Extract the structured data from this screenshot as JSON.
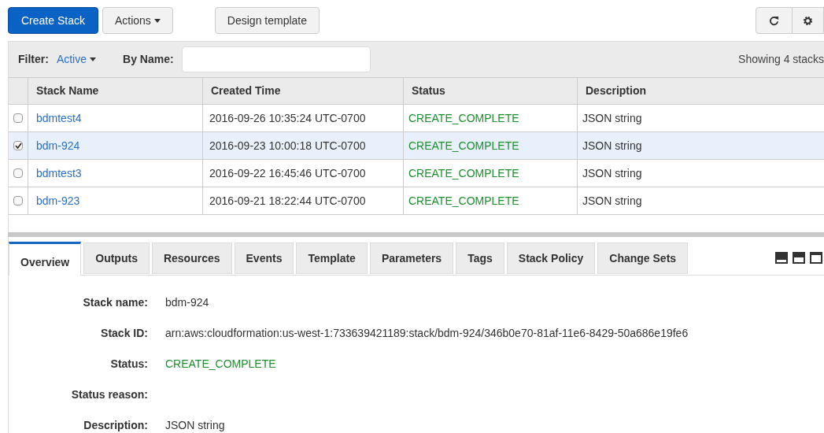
{
  "toolbar": {
    "create_button": "Create Stack",
    "actions_button": "Actions",
    "design_button": "Design template"
  },
  "filter": {
    "label": "Filter:",
    "value": "Active",
    "name_label": "By Name:",
    "count": "Showing 4 stacks"
  },
  "table": {
    "columns": [
      "Stack Name",
      "Created Time",
      "Status",
      "Description"
    ],
    "rows": [
      {
        "selected": false,
        "name": "bdmtest4",
        "created": "2016-09-26 10:35:24 UTC-0700",
        "status": "CREATE_COMPLETE",
        "description": "JSON string"
      },
      {
        "selected": true,
        "name": "bdm-924",
        "created": "2016-09-23 10:00:18 UTC-0700",
        "status": "CREATE_COMPLETE",
        "description": "JSON string"
      },
      {
        "selected": false,
        "name": "bdmtest3",
        "created": "2016-09-22 16:45:46 UTC-0700",
        "status": "CREATE_COMPLETE",
        "description": "JSON string"
      },
      {
        "selected": false,
        "name": "bdm-923",
        "created": "2016-09-21 18:22:44 UTC-0700",
        "status": "CREATE_COMPLETE",
        "description": "JSON string"
      }
    ]
  },
  "tabs": [
    {
      "label": "Overview",
      "selected": true
    },
    {
      "label": "Outputs",
      "selected": false
    },
    {
      "label": "Resources",
      "selected": false
    },
    {
      "label": "Events",
      "selected": false
    },
    {
      "label": "Template",
      "selected": false
    },
    {
      "label": "Parameters",
      "selected": false
    },
    {
      "label": "Tags",
      "selected": false
    },
    {
      "label": "Stack Policy",
      "selected": false
    },
    {
      "label": "Change Sets",
      "selected": false
    }
  ],
  "details": [
    {
      "label": "Stack name:",
      "value": "bdm-924",
      "kind": "plain"
    },
    {
      "label": "Stack ID:",
      "value": "arn:aws:cloudformation:us-west-1:733639421189:stack/bdm-924/346b0e70-81af-11e6-8429-50a686e19fe6",
      "kind": "plain"
    },
    {
      "label": "Status:",
      "value": "CREATE_COMPLETE",
      "kind": "status"
    },
    {
      "label": "Status reason:",
      "kind": "plain"
    },
    {
      "label": "Description:",
      "value": "JSON string",
      "kind": "plain"
    }
  ]
}
